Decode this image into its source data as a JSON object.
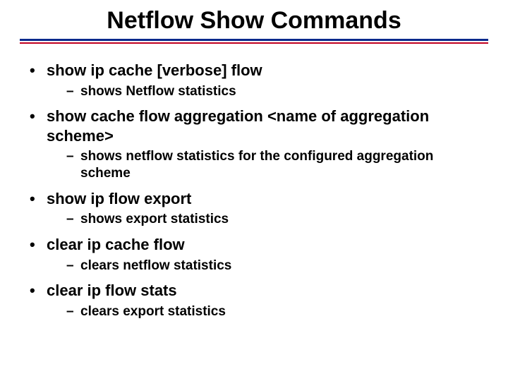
{
  "title": "Netflow Show Commands",
  "items": [
    {
      "label": "show ip cache [verbose] flow",
      "sub": [
        "shows Netflow statistics"
      ]
    },
    {
      "label": "show cache flow aggregation <name of aggregation scheme>",
      "sub": [
        "shows netflow statistics for the configured aggregation scheme"
      ]
    },
    {
      "label": "show ip flow export",
      "sub": [
        "shows export statistics"
      ]
    },
    {
      "label": "clear ip cache flow",
      "sub": [
        "clears netflow statistics"
      ]
    },
    {
      "label": "clear ip flow stats",
      "sub": [
        "clears export statistics"
      ]
    }
  ]
}
